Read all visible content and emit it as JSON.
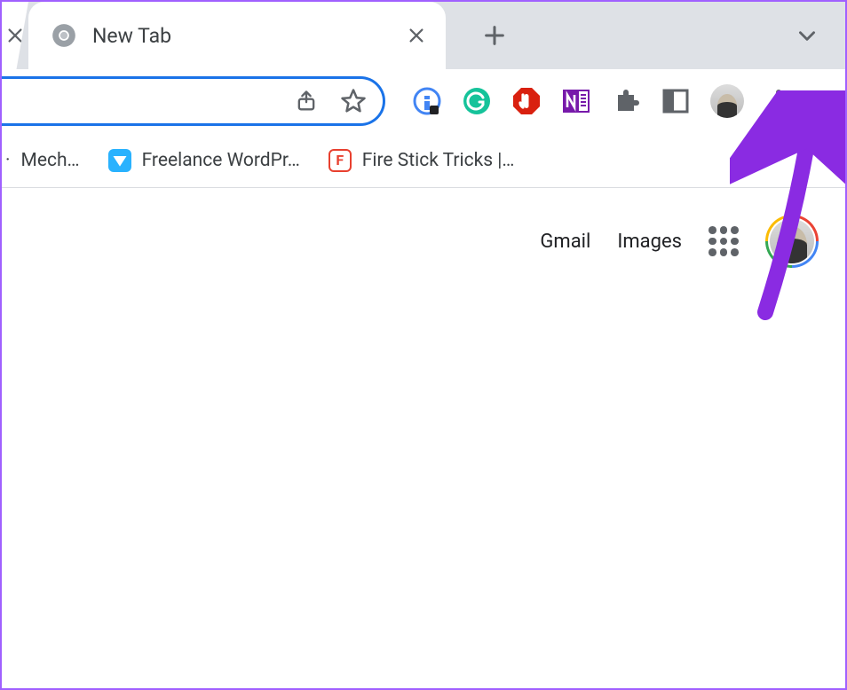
{
  "tab": {
    "title": "New Tab"
  },
  "bookmarks": [
    {
      "label": "Mech…",
      "icon": "generic"
    },
    {
      "label": "Freelance WordPr…",
      "icon": "freelancer"
    },
    {
      "label": "Fire Stick Tricks |…",
      "icon": "firestick"
    }
  ],
  "ntp": {
    "gmail": "Gmail",
    "images": "Images"
  },
  "toolbar_extensions": [
    {
      "name": "extension-1",
      "color": "#4285f4"
    },
    {
      "name": "grammarly",
      "color": "#15c39a"
    },
    {
      "name": "adblock",
      "color": "#d9200f"
    },
    {
      "name": "onenote",
      "color": "#7719aa"
    },
    {
      "name": "extensions-puzzle",
      "color": "#5f6368"
    },
    {
      "name": "side-panel",
      "color": "#5f6368"
    }
  ],
  "annotation": {
    "arrow_color": "#8a2be2"
  }
}
